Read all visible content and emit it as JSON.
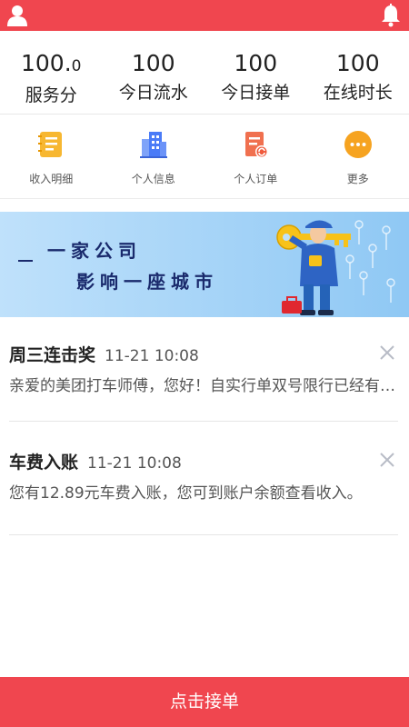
{
  "header": {
    "user_icon": "user-icon",
    "bell_icon": "bell-icon",
    "color": "#f0464f"
  },
  "stats": [
    {
      "value": "100.",
      "value_small": "0",
      "label": "服务分"
    },
    {
      "value": "100",
      "label": "今日流水"
    },
    {
      "value": "100",
      "label": "今日接单"
    },
    {
      "value": "100",
      "label": "在线时长"
    }
  ],
  "menu": [
    {
      "label": "收入明细",
      "icon": "income-detail-icon",
      "color": "#f5a623"
    },
    {
      "label": "个人信息",
      "icon": "building-icon",
      "color": "#4a7bf7"
    },
    {
      "label": "个人订单",
      "icon": "order-icon",
      "color": "#f05a3c"
    },
    {
      "label": "更多",
      "icon": "more-icon",
      "color": "#f6a320"
    }
  ],
  "banner": {
    "line1": "一家公司",
    "line2": "影响一座城市"
  },
  "notices": [
    {
      "title": "周三连击奖",
      "time": "11-21 10:08",
      "body": "亲爱的美团打车师傅，您好！自实行单双号限行已经有一段时间了"
    },
    {
      "title": "车费入账",
      "time": "11-21 10:08",
      "body": "您有12.89元车费入账，您可到账户余额查看收入。"
    }
  ],
  "bottom_button": "点击接单"
}
